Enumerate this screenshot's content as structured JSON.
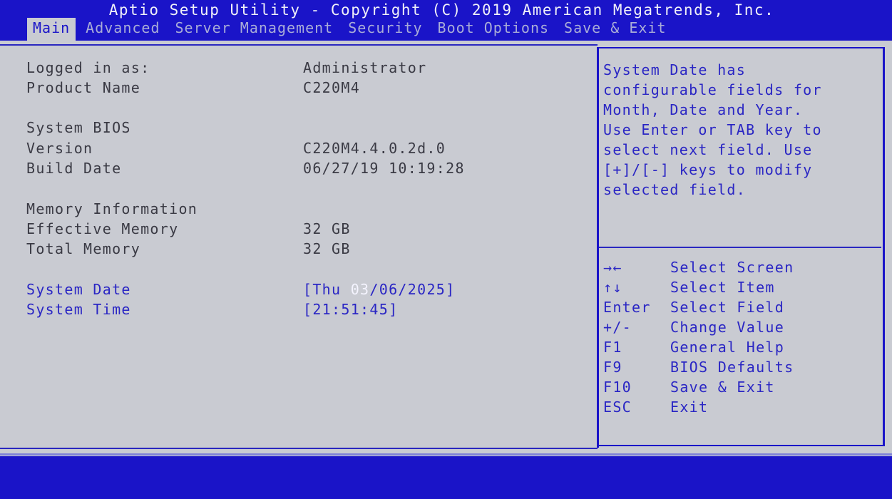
{
  "header": {
    "title": "Aptio Setup Utility - Copyright (C) 2019 American Megatrends, Inc.",
    "tabs": [
      {
        "label": "Main",
        "active": true
      },
      {
        "label": "Advanced",
        "active": false
      },
      {
        "label": "Server Management",
        "active": false
      },
      {
        "label": "Security",
        "active": false
      },
      {
        "label": "Boot Options",
        "active": false
      },
      {
        "label": "Save & Exit",
        "active": false
      }
    ]
  },
  "main": {
    "logged_in": {
      "label": "Logged in as:",
      "value": "Administrator"
    },
    "product": {
      "label": "Product Name",
      "value": "C220M4"
    },
    "bios_section": "System BIOS",
    "version": {
      "label": "Version",
      "value": "C220M4.4.0.2d.0"
    },
    "build_date": {
      "label": "Build Date",
      "value": "06/27/19 10:19:28"
    },
    "memory_section": "Memory Information",
    "effective_memory": {
      "label": "Effective Memory",
      "value": "32 GB"
    },
    "total_memory": {
      "label": "Total Memory",
      "value": "32 GB"
    },
    "system_date": {
      "label": "System Date",
      "prefix": "[Thu ",
      "highlighted_field": "03",
      "suffix": "/06/2025]"
    },
    "system_time": {
      "label": "System Time",
      "value": "[21:51:45]"
    }
  },
  "help": {
    "text": "System Date has\nconfigurable fields for\nMonth, Date and Year.\nUse Enter or TAB key to\nselect next field. Use\n[+]/[-] keys to modify\nselected field.",
    "keys": [
      {
        "key": "→←",
        "action": "Select Screen"
      },
      {
        "key": "↑↓",
        "action": "Select Item"
      },
      {
        "key": "Enter",
        "action": "Select Field"
      },
      {
        "key": "+/-",
        "action": "Change Value"
      },
      {
        "key": "F1",
        "action": "General Help"
      },
      {
        "key": "F9",
        "action": "BIOS Defaults"
      },
      {
        "key": "F10",
        "action": "Save & Exit"
      },
      {
        "key": "ESC",
        "action": "Exit"
      }
    ]
  },
  "colors": {
    "accent": "#1a14c8",
    "background": "#c9cbd2",
    "text": "#3a3a44",
    "highlight": "#f4f4ff"
  }
}
